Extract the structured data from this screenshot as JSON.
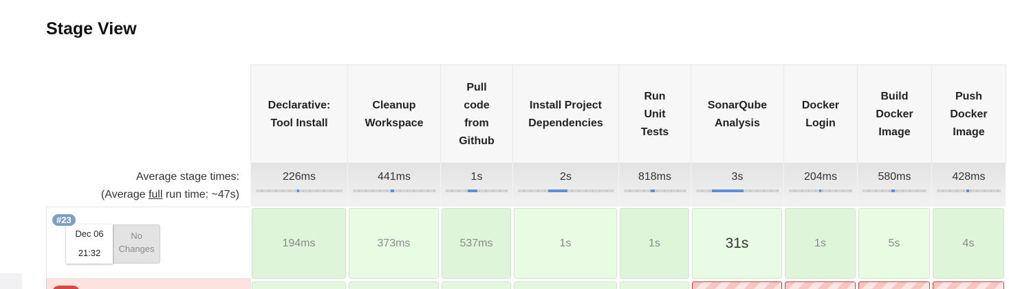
{
  "page": {
    "title": "Stage View"
  },
  "summary": {
    "average_label": "Average stage times:",
    "full_run_prefix": "(Average ",
    "full_run_word": "full",
    "full_run_suffix": " run time: ~47s)"
  },
  "stages": [
    {
      "name": "Declarative:\nTool Install",
      "avg": "226ms",
      "avg_fraction": 0.02
    },
    {
      "name": "Cleanup\nWorkspace",
      "avg": "441ms",
      "avg_fraction": 0.04
    },
    {
      "name": "Pull\ncode\nfrom\nGithub",
      "avg": "1s",
      "avg_fraction": 0.15
    },
    {
      "name": "Install Project\nDependencies",
      "avg": "2s",
      "avg_fraction": 0.2
    },
    {
      "name": "Run\nUnit\nTests",
      "avg": "818ms",
      "avg_fraction": 0.07
    },
    {
      "name": "SonarQube\nAnalysis",
      "avg": "3s",
      "avg_fraction": 0.38
    },
    {
      "name": "Docker\nLogin",
      "avg": "204ms",
      "avg_fraction": 0.02
    },
    {
      "name": "Build\nDocker\nImage",
      "avg": "580ms",
      "avg_fraction": 0.05
    },
    {
      "name": "Push\nDocker\nImage",
      "avg": "428ms",
      "avg_fraction": 0.04
    }
  ],
  "builds": [
    {
      "number": "#23",
      "date": "Dec 06",
      "time": "21:32",
      "changes": "No\nChanges",
      "status": "success",
      "durations": [
        "194ms",
        "373ms",
        "537ms",
        "1s",
        "1s",
        "31s",
        "1s",
        "5s",
        "4s"
      ]
    },
    {
      "status": "failed",
      "stage_status": [
        "ok",
        "ok",
        "ok",
        "ok",
        "ok",
        "fail",
        "fail",
        "fail",
        "fail"
      ]
    }
  ],
  "colors": {
    "success_tile": "#dff5da",
    "failed_tile": "#f6c6c3",
    "failed_border": "#c9413c",
    "avg_bar_fill": "#5b8fd9",
    "build_badge": "#7f9fc4"
  }
}
